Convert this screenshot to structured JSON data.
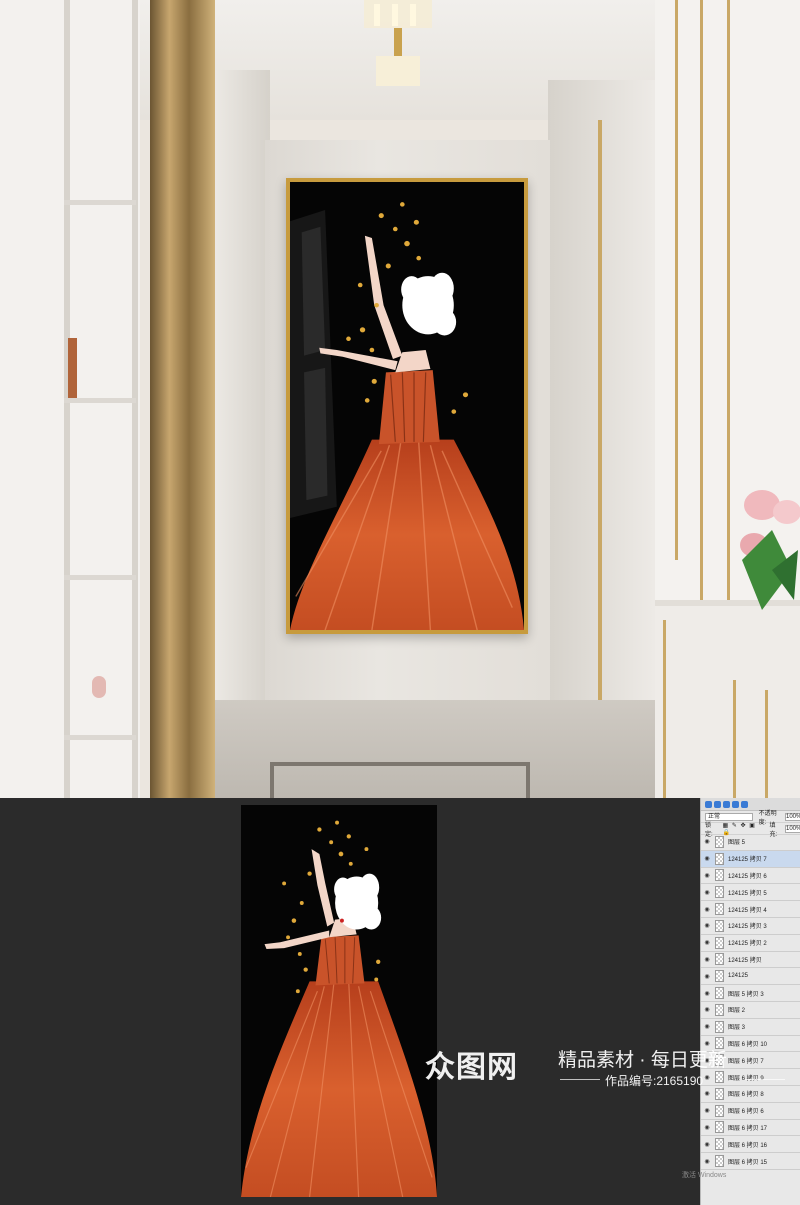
{
  "ps_panel": {
    "blend_mode": "正常",
    "opacity_label": "不透明度:",
    "opacity_value": "100%",
    "lock_label": "锁定:",
    "fill_label": "填充:",
    "fill_value": "100%",
    "layers": [
      {
        "name": "图层 5",
        "selected": false
      },
      {
        "name": "124125 拷贝 7",
        "selected": true
      },
      {
        "name": "124125 拷贝 6",
        "selected": false
      },
      {
        "name": "124125 拷贝 5",
        "selected": false
      },
      {
        "name": "124125 拷贝 4",
        "selected": false
      },
      {
        "name": "124125 拷贝 3",
        "selected": false
      },
      {
        "name": "124125 拷贝 2",
        "selected": false
      },
      {
        "name": "124125 拷贝",
        "selected": false
      },
      {
        "name": "124125",
        "selected": false
      },
      {
        "name": "图层 5 拷贝 3",
        "selected": false
      },
      {
        "name": "图层 2",
        "selected": false
      },
      {
        "name": "图层 3",
        "selected": false
      },
      {
        "name": "图层 6 拷贝 10",
        "selected": false
      },
      {
        "name": "图层 6 拷贝 7",
        "selected": false
      },
      {
        "name": "图层 6 拷贝 9",
        "selected": false
      },
      {
        "name": "图层 6 拷贝 8",
        "selected": false
      },
      {
        "name": "图层 6 拷贝 6",
        "selected": false
      },
      {
        "name": "图层 6 拷贝 17",
        "selected": false
      },
      {
        "name": "图层 6 拷贝 16",
        "selected": false
      },
      {
        "name": "图层 6 拷贝 15",
        "selected": false
      }
    ],
    "activate_text": "激活 Windows"
  },
  "watermark": {
    "logo": "众图网",
    "title": "精品素材 · 每日更新",
    "sub": "作品编号:2165190"
  },
  "colors": {
    "frame_gold": "#c79b3e",
    "dress_orange": "#d2572a",
    "butterfly_gold": "#e0a93a",
    "workspace": "#2b2b2b"
  }
}
